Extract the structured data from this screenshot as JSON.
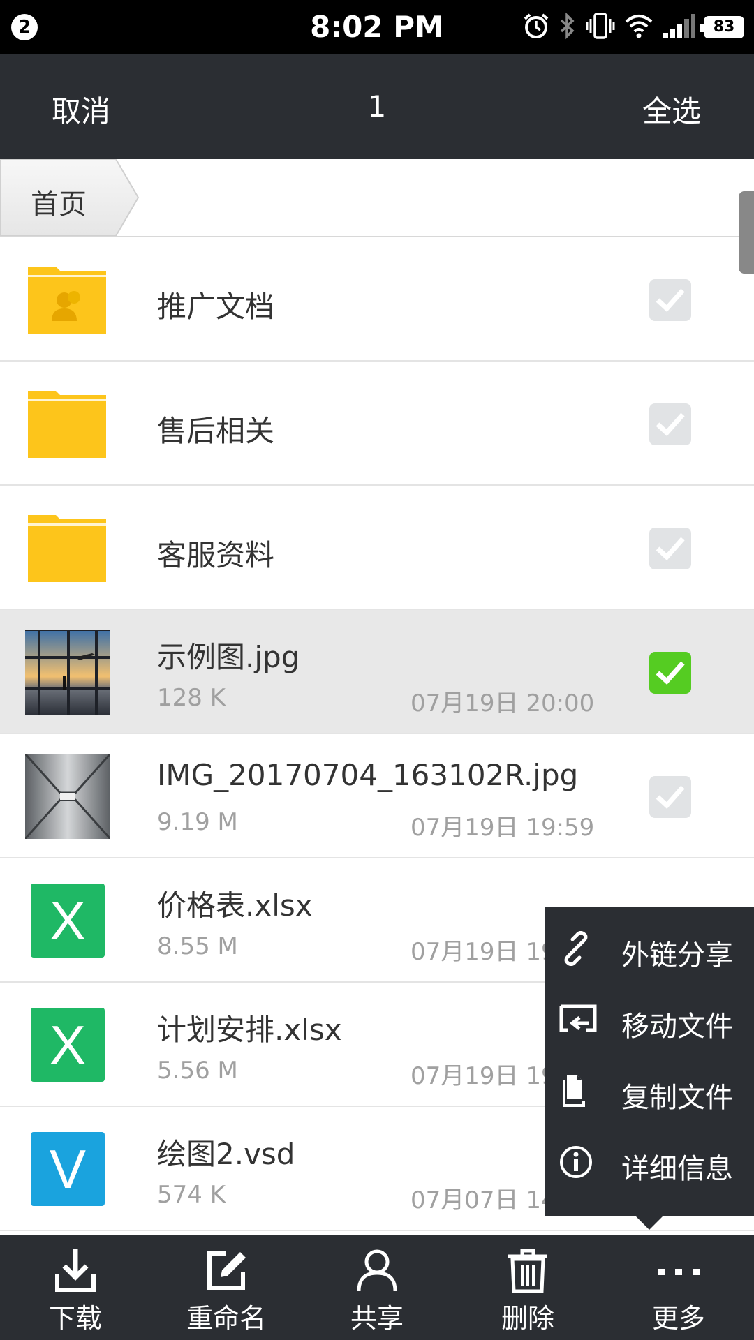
{
  "status_bar": {
    "notification_count": "2",
    "time": "8:02 PM",
    "battery": "83",
    "icons": [
      "alarm-icon",
      "bluetooth-icon",
      "vibrate-icon",
      "wifi-icon",
      "signal-icon",
      "battery-icon"
    ]
  },
  "action_bar": {
    "cancel": "取消",
    "selected_count": "1",
    "select_all": "全选"
  },
  "breadcrumb": {
    "home": "首页"
  },
  "files": [
    {
      "name": "推广文档",
      "type": "shared-folder",
      "checked": false
    },
    {
      "name": "售后相关",
      "type": "folder",
      "checked": false
    },
    {
      "name": "客服资料",
      "type": "folder",
      "checked": false
    },
    {
      "name": "示例图.jpg",
      "type": "image",
      "size": "128 K",
      "date": "07月19日 20:00",
      "checked": true
    },
    {
      "name": "IMG_20170704_163102R.jpg",
      "type": "image",
      "size": "9.19 M",
      "date": "07月19日 19:59",
      "checked": false
    },
    {
      "name": "价格表.xlsx",
      "type": "excel",
      "icon_letter": "X",
      "size": "8.55 M",
      "date": "07月19日 19",
      "checked": false
    },
    {
      "name": "计划安排.xlsx",
      "type": "excel",
      "icon_letter": "X",
      "size": "5.56 M",
      "date": "07月19日 19",
      "checked": false
    },
    {
      "name": "绘图2.vsd",
      "type": "visio",
      "icon_letter": "V",
      "size": "574 K",
      "date": "07月07日 14",
      "checked": false
    }
  ],
  "more_menu": [
    {
      "label": "外链分享",
      "icon": "link-icon"
    },
    {
      "label": "移动文件",
      "icon": "move-file-icon"
    },
    {
      "label": "复制文件",
      "icon": "copy-file-icon"
    },
    {
      "label": "详细信息",
      "icon": "info-icon"
    }
  ],
  "toolbar": [
    {
      "label": "下载",
      "icon": "download-icon"
    },
    {
      "label": "重命名",
      "icon": "rename-icon"
    },
    {
      "label": "共享",
      "icon": "share-user-icon"
    },
    {
      "label": "删除",
      "icon": "trash-icon"
    },
    {
      "label": "更多",
      "icon": "more-icon"
    }
  ],
  "colors": {
    "bar_bg": "#2b2e33",
    "folder_yellow": "#fdc51b",
    "check_on": "#55cc22",
    "excel_green": "#1fb865",
    "visio_blue": "#1aa3de"
  }
}
